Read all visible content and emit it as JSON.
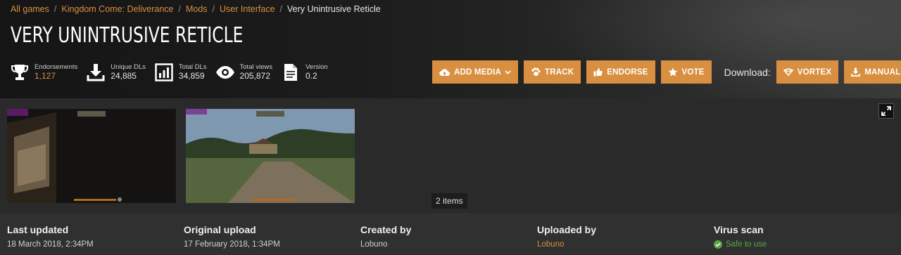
{
  "breadcrumb": [
    "All games",
    "Kingdom Come: Deliverance",
    "Mods",
    "User Interface"
  ],
  "breadcrumb_current": "Very Unintrusive Reticle",
  "title": "VERY UNINTRUSIVE RETICLE",
  "stats": {
    "endorsements": {
      "label": "Endorsements",
      "value": "1,127",
      "icon": "trophy-icon"
    },
    "unique_dls": {
      "label": "Unique DLs",
      "value": "24,885",
      "icon": "download-icon"
    },
    "total_dls": {
      "label": "Total DLs",
      "value": "34,859",
      "icon": "bar-chart-icon"
    },
    "total_views": {
      "label": "Total views",
      "value": "205,872",
      "icon": "eye-icon"
    },
    "version": {
      "label": "Version",
      "value": "0.2",
      "icon": "document-icon"
    }
  },
  "actions": {
    "add_media": "ADD MEDIA",
    "track": "TRACK",
    "endorse": "ENDORSE",
    "vote": "VOTE",
    "download_label": "Download:",
    "vortex": "VORTEX",
    "manual": "MANUAL"
  },
  "gallery": {
    "items_count": "2 items"
  },
  "meta": {
    "last_updated": {
      "label": "Last updated",
      "value": "18 March 2018,  2:34PM"
    },
    "original_upload": {
      "label": "Original upload",
      "value": "17 February 2018,  1:34PM"
    },
    "created_by": {
      "label": "Created by",
      "value": "Lobuno"
    },
    "uploaded_by": {
      "label": "Uploaded by",
      "value": "Lobuno"
    },
    "virus_scan": {
      "label": "Virus scan",
      "value": "Safe to use"
    }
  },
  "colors": {
    "accent": "#d98f40",
    "safe": "#56a843",
    "background": "#2b2b2b"
  }
}
